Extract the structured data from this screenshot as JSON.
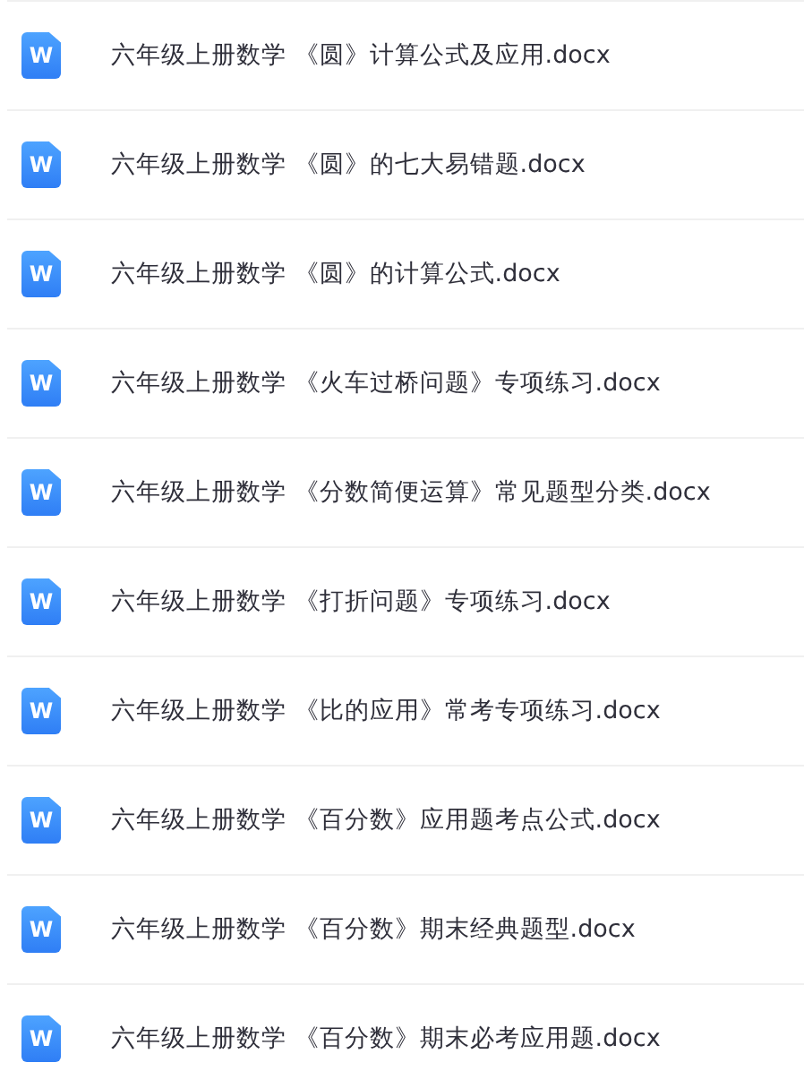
{
  "files": [
    {
      "badge": "W",
      "name": "六年级上册数学 《圆》计算公式及应用.docx"
    },
    {
      "badge": "W",
      "name": "六年级上册数学 《圆》的七大易错题.docx"
    },
    {
      "badge": "W",
      "name": "六年级上册数学 《圆》的计算公式.docx"
    },
    {
      "badge": "W",
      "name": "六年级上册数学 《火车过桥问题》专项练习.docx"
    },
    {
      "badge": "W",
      "name": "六年级上册数学 《分数简便运算》常见题型分类.docx"
    },
    {
      "badge": "W",
      "name": "六年级上册数学 《打折问题》专项练习.docx"
    },
    {
      "badge": "W",
      "name": "六年级上册数学 《比的应用》常考专项练习.docx"
    },
    {
      "badge": "W",
      "name": "六年级上册数学 《百分数》应用题考点公式.docx"
    },
    {
      "badge": "W",
      "name": "六年级上册数学 《百分数》期末经典题型.docx"
    },
    {
      "badge": "W",
      "name": "六年级上册数学 《百分数》期末必考应用题.docx"
    }
  ]
}
